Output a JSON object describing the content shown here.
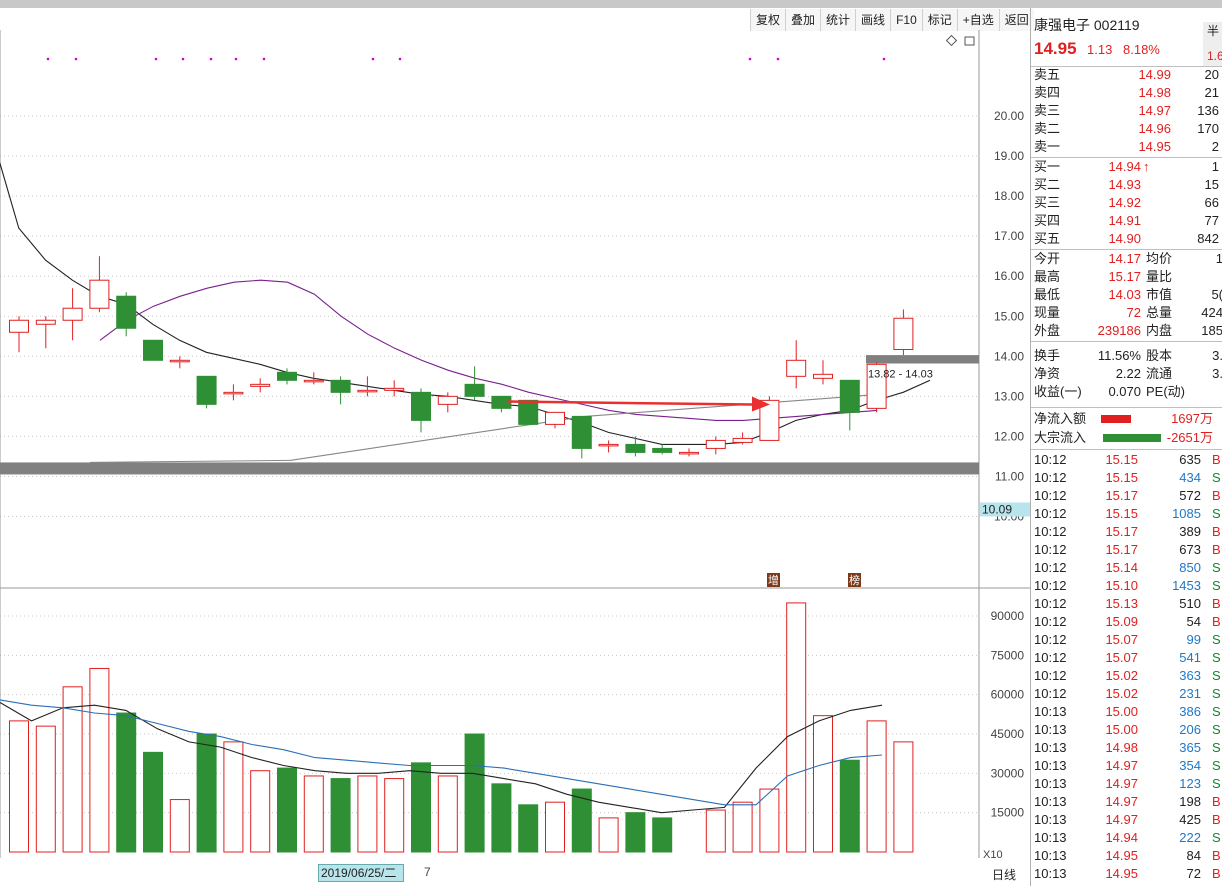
{
  "toolbar": [
    "复权",
    "叠加",
    "统计",
    "画线",
    "F10",
    "标记",
    "+自选",
    "返回"
  ],
  "chart_data": {
    "type": "candlestick",
    "price_axis": {
      "min": 10,
      "max": 20,
      "ticks": [
        "20.00",
        "19.00",
        "18.00",
        "17.00",
        "16.00",
        "15.00",
        "14.00",
        "13.00",
        "12.00",
        "11.00",
        "10.00"
      ]
    },
    "volume_axis": {
      "min": 0,
      "max": 100000,
      "ticks": [
        "90000",
        "75000",
        "60000",
        "45000",
        "30000",
        "15000"
      ]
    },
    "candles": [
      {
        "o": 14.6,
        "c": 14.9,
        "h": 15.0,
        "l": 14.1
      },
      {
        "o": 14.8,
        "c": 14.9,
        "h": 15.0,
        "l": 14.2
      },
      {
        "o": 14.9,
        "c": 15.2,
        "h": 15.7,
        "l": 14.4
      },
      {
        "o": 15.2,
        "c": 15.9,
        "h": 16.5,
        "l": 15.1
      },
      {
        "o": 15.5,
        "c": 14.7,
        "h": 15.6,
        "l": 14.5
      },
      {
        "o": 14.4,
        "c": 13.9,
        "h": 14.4,
        "l": 13.9
      },
      {
        "o": 13.9,
        "c": 13.9,
        "h": 14.0,
        "l": 13.7
      },
      {
        "o": 13.5,
        "c": 12.8,
        "h": 13.5,
        "l": 12.7
      },
      {
        "o": 13.1,
        "c": 13.1,
        "h": 13.3,
        "l": 12.9
      },
      {
        "o": 13.25,
        "c": 13.3,
        "h": 13.45,
        "l": 13.1
      },
      {
        "o": 13.6,
        "c": 13.4,
        "h": 13.7,
        "l": 13.3
      },
      {
        "o": 13.4,
        "c": 13.4,
        "h": 13.6,
        "l": 13.3
      },
      {
        "o": 13.4,
        "c": 13.1,
        "h": 13.5,
        "l": 12.8
      },
      {
        "o": 13.15,
        "c": 13.15,
        "h": 13.5,
        "l": 13.0
      },
      {
        "o": 13.15,
        "c": 13.2,
        "h": 13.4,
        "l": 13.0
      },
      {
        "o": 13.1,
        "c": 12.4,
        "h": 13.2,
        "l": 12.1
      },
      {
        "o": 12.8,
        "c": 13.0,
        "h": 13.1,
        "l": 12.6
      },
      {
        "o": 13.3,
        "c": 13.0,
        "h": 13.75,
        "l": 12.9
      },
      {
        "o": 13.0,
        "c": 12.7,
        "h": 13.0,
        "l": 12.6
      },
      {
        "o": 12.9,
        "c": 12.3,
        "h": 12.9,
        "l": 12.3
      },
      {
        "o": 12.3,
        "c": 12.6,
        "h": 12.6,
        "l": 12.2
      },
      {
        "o": 12.5,
        "c": 11.7,
        "h": 12.5,
        "l": 11.45
      },
      {
        "o": 11.8,
        "c": 11.8,
        "h": 11.9,
        "l": 11.6
      },
      {
        "o": 11.8,
        "c": 11.6,
        "h": 12.0,
        "l": 11.5
      },
      {
        "o": 11.7,
        "c": 11.6,
        "h": 11.8,
        "l": 11.55
      },
      {
        "o": 11.6,
        "c": 11.6,
        "h": 11.7,
        "l": 11.5
      },
      {
        "o": 11.7,
        "c": 11.9,
        "h": 12.0,
        "l": 11.55
      },
      {
        "o": 11.85,
        "c": 11.95,
        "h": 12.1,
        "l": 11.8
      },
      {
        "o": 11.9,
        "c": 12.9,
        "h": 13.0,
        "l": 11.9
      },
      {
        "o": 13.5,
        "c": 13.9,
        "h": 14.4,
        "l": 13.2
      },
      {
        "o": 13.45,
        "c": 13.55,
        "h": 13.9,
        "l": 13.3
      },
      {
        "o": 13.4,
        "c": 12.6,
        "h": 13.4,
        "l": 12.15
      },
      {
        "o": 12.7,
        "c": 13.8,
        "h": 13.85,
        "l": 12.6
      },
      {
        "o": 14.17,
        "c": 14.95,
        "h": 15.17,
        "l": 14.03
      }
    ],
    "volumes": [
      50000,
      48000,
      63000,
      70000,
      53000,
      38000,
      20000,
      45000,
      42000,
      31000,
      32000,
      29000,
      28000,
      29000,
      28000,
      34000,
      29000,
      45000,
      26000,
      18000,
      19000,
      24000,
      13000,
      15000,
      13000,
      0,
      16000,
      19000,
      24000,
      95000,
      52000,
      35000,
      50000,
      42000
    ],
    "ma_short": [
      19.5,
      17.2,
      16.4,
      15.9,
      15.5,
      15.3,
      14.8,
      14.4,
      14.1,
      13.95,
      13.8,
      13.6,
      13.45,
      13.35,
      13.25,
      13.15,
      13.05,
      13.0,
      12.9,
      12.8,
      12.75,
      12.55,
      12.35,
      12.1,
      11.95,
      11.8,
      11.8,
      11.8,
      11.85,
      12.1,
      12.4,
      12.55,
      12.65,
      12.9,
      13.1,
      13.4
    ],
    "ma_purple": [
      14.4,
      14.9,
      15.25,
      15.5,
      15.7,
      15.85,
      15.9,
      15.85,
      15.55,
      15.0,
      14.55,
      14.2,
      13.9,
      13.65,
      13.45,
      13.3,
      13.1,
      12.95,
      12.8,
      12.65,
      12.55,
      12.5,
      12.45,
      12.4,
      12.4,
      12.45,
      12.5,
      12.55,
      12.6,
      12.65
    ],
    "ma_gray": [
      11.4,
      11.5,
      11.6,
      11.7,
      11.8,
      11.9,
      12.0,
      12.1,
      12.2,
      12.3,
      12.4,
      12.5,
      12.55,
      12.6,
      12.65,
      12.7,
      12.75,
      12.8,
      12.85,
      12.9,
      12.95,
      13.0,
      13.05
    ],
    "vol_ma_black": [
      57000,
      50000,
      55000,
      56000,
      54000,
      47000,
      42000,
      40000,
      36000,
      33000,
      31000,
      30000,
      30000,
      31000,
      30000,
      30000,
      28000,
      26000,
      22000,
      19000,
      17000,
      15000,
      16000,
      17000,
      32000,
      44000,
      50000,
      54000,
      56000
    ],
    "vol_ma_blue": [
      58000,
      56000,
      55000,
      53000,
      52000,
      49000,
      46000,
      44000,
      41000,
      39000,
      36000,
      35000,
      34000,
      33000,
      33000,
      33000,
      32000,
      30000,
      28000,
      26000,
      24000,
      22000,
      20000,
      18000,
      18000,
      29000,
      33000,
      36000,
      37000
    ],
    "support_band": {
      "from": 11.05,
      "to": 11.35
    },
    "resistance_band_label": "13.82 - 14.03",
    "resistance_band": {
      "from": 13.82,
      "to": 14.03
    },
    "current_price_label": "10.09",
    "markers": [
      "增",
      "榜"
    ],
    "x_scale_label": "X10"
  },
  "header": {
    "name": "康强电子 002119",
    "price": "14.95",
    "change": "1.13",
    "pct": "8.18%",
    "tab": "半",
    "tab2": "1.6"
  },
  "asks": [
    {
      "label": "卖五",
      "price": "14.99",
      "vol": "20"
    },
    {
      "label": "卖四",
      "price": "14.98",
      "vol": "21"
    },
    {
      "label": "卖三",
      "price": "14.97",
      "vol": "136"
    },
    {
      "label": "卖二",
      "price": "14.96",
      "vol": "170"
    },
    {
      "label": "卖一",
      "price": "14.95",
      "vol": "2"
    }
  ],
  "bids": [
    {
      "label": "买一",
      "price": "14.94",
      "vol": "1"
    },
    {
      "label": "买二",
      "price": "14.93",
      "vol": "15"
    },
    {
      "label": "买三",
      "price": "14.92",
      "vol": "66"
    },
    {
      "label": "买四",
      "price": "14.91",
      "vol": "77"
    },
    {
      "label": "买五",
      "price": "14.90",
      "vol": "842"
    }
  ],
  "stats": [
    {
      "l1": "今开",
      "v1": "14.17",
      "l2": "均价",
      "v2": "1"
    },
    {
      "l1": "最高",
      "v1": "15.17",
      "l2": "量比",
      "v2": ""
    },
    {
      "l1": "最低",
      "v1": "14.03",
      "l2": "市值",
      "v2": "5("
    },
    {
      "l1": "现量",
      "v1": "72",
      "l2": "总量",
      "v2": "424"
    },
    {
      "l1": "外盘",
      "v1": "239186",
      "l2": "内盘",
      "v2": "185"
    }
  ],
  "stats2": [
    {
      "l1": "换手",
      "v1": "11.56%",
      "l2": "股本",
      "v2": "3."
    },
    {
      "l1": "净资",
      "v1": "2.22",
      "l2": "流通",
      "v2": "3."
    },
    {
      "l1": "收益(一)",
      "v1": "0.070",
      "l2": "PE(动)",
      "v2": ""
    }
  ],
  "flows": [
    {
      "label": "净流入额",
      "value": "1697万"
    },
    {
      "label": "大宗流入",
      "value": "-2651万"
    }
  ],
  "ticks": [
    {
      "t": "10:12",
      "p": "15.15",
      "v": "635",
      "s": "B"
    },
    {
      "t": "10:12",
      "p": "15.15",
      "v": "434",
      "s": "S"
    },
    {
      "t": "10:12",
      "p": "15.17",
      "v": "572",
      "s": "B"
    },
    {
      "t": "10:12",
      "p": "15.15",
      "v": "1085",
      "s": "S"
    },
    {
      "t": "10:12",
      "p": "15.17",
      "v": "389",
      "s": "B"
    },
    {
      "t": "10:12",
      "p": "15.17",
      "v": "673",
      "s": "B"
    },
    {
      "t": "10:12",
      "p": "15.14",
      "v": "850",
      "s": "S"
    },
    {
      "t": "10:12",
      "p": "15.10",
      "v": "1453",
      "s": "S"
    },
    {
      "t": "10:12",
      "p": "15.13",
      "v": "510",
      "s": "B"
    },
    {
      "t": "10:12",
      "p": "15.09",
      "v": "54",
      "s": "B"
    },
    {
      "t": "10:12",
      "p": "15.07",
      "v": "99",
      "s": "S"
    },
    {
      "t": "10:12",
      "p": "15.07",
      "v": "541",
      "s": "S"
    },
    {
      "t": "10:12",
      "p": "15.02",
      "v": "363",
      "s": "S"
    },
    {
      "t": "10:12",
      "p": "15.02",
      "v": "231",
      "s": "S"
    },
    {
      "t": "10:13",
      "p": "15.00",
      "v": "386",
      "s": "S"
    },
    {
      "t": "10:13",
      "p": "15.00",
      "v": "206",
      "s": "S"
    },
    {
      "t": "10:13",
      "p": "14.98",
      "v": "365",
      "s": "S"
    },
    {
      "t": "10:13",
      "p": "14.97",
      "v": "354",
      "s": "S"
    },
    {
      "t": "10:13",
      "p": "14.97",
      "v": "123",
      "s": "S"
    },
    {
      "t": "10:13",
      "p": "14.97",
      "v": "198",
      "s": "B"
    },
    {
      "t": "10:13",
      "p": "14.97",
      "v": "425",
      "s": "B"
    },
    {
      "t": "10:13",
      "p": "14.94",
      "v": "222",
      "s": "S"
    },
    {
      "t": "10:13",
      "p": "14.95",
      "v": "84",
      "s": "B"
    },
    {
      "t": "10:13",
      "p": "14.95",
      "v": "72",
      "s": "B"
    }
  ],
  "bottom": {
    "date": "2019/06/25/二",
    "tail": "7",
    "period": "日线"
  },
  "colors": {
    "up": "#e02020",
    "down": "#2f8f34",
    "ma_purple": "#7a1f8f",
    "ma_gray": "#888888",
    "vol_blue": "#2a6fb8",
    "band": "#808080",
    "arrow": "#e83030"
  }
}
